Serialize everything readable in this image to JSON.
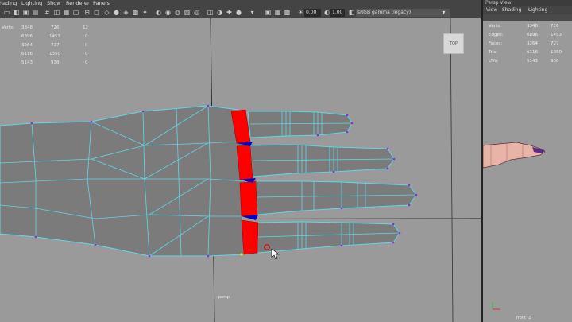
{
  "menu": [
    "hading",
    "Lighting",
    "Show",
    "Renderer",
    "Panels"
  ],
  "toolbar": {
    "exposure": "0.00",
    "gamma": "1.00",
    "color_space": "sRGB gamma (legacy)"
  },
  "hud": {
    "rows": [
      {
        "label": "Verts:",
        "a": "3348",
        "b": "726",
        "c": "12"
      },
      {
        "label": "Edges:",
        "a": "6896",
        "b": "1453",
        "c": "0"
      },
      {
        "label": "Faces:",
        "a": "3264",
        "b": "727",
        "c": "0"
      },
      {
        "label": "Tris:",
        "a": "6116",
        "b": "1350",
        "c": "0"
      },
      {
        "label": "UVs:",
        "a": "5143",
        "b": "938",
        "c": "0"
      }
    ]
  },
  "viewcube_label": "TOP",
  "camera_label": "persp",
  "right_panel": {
    "title": "Persp View",
    "menu": [
      "View",
      "Shading",
      "Lighting"
    ],
    "hud": [
      {
        "label": "Verts:",
        "a": "3348",
        "b": "726"
      },
      {
        "label": "Edges:",
        "a": "6896",
        "b": "1453"
      },
      {
        "label": "Faces:",
        "a": "3264",
        "b": "727"
      },
      {
        "label": "Tris:",
        "a": "6116",
        "b": "1350"
      },
      {
        "label": "UVs:",
        "a": "5143",
        "b": "938"
      }
    ],
    "camera_label": "front -Z"
  },
  "colors": {
    "viewport_bg": "#9a9a9a",
    "mesh_fill": "#7b7b7b",
    "wire": "#5fd7e8",
    "selected_face": "#ff0000",
    "edge_loop_marker": "#0000cc",
    "vertex": "#8a2be2"
  }
}
